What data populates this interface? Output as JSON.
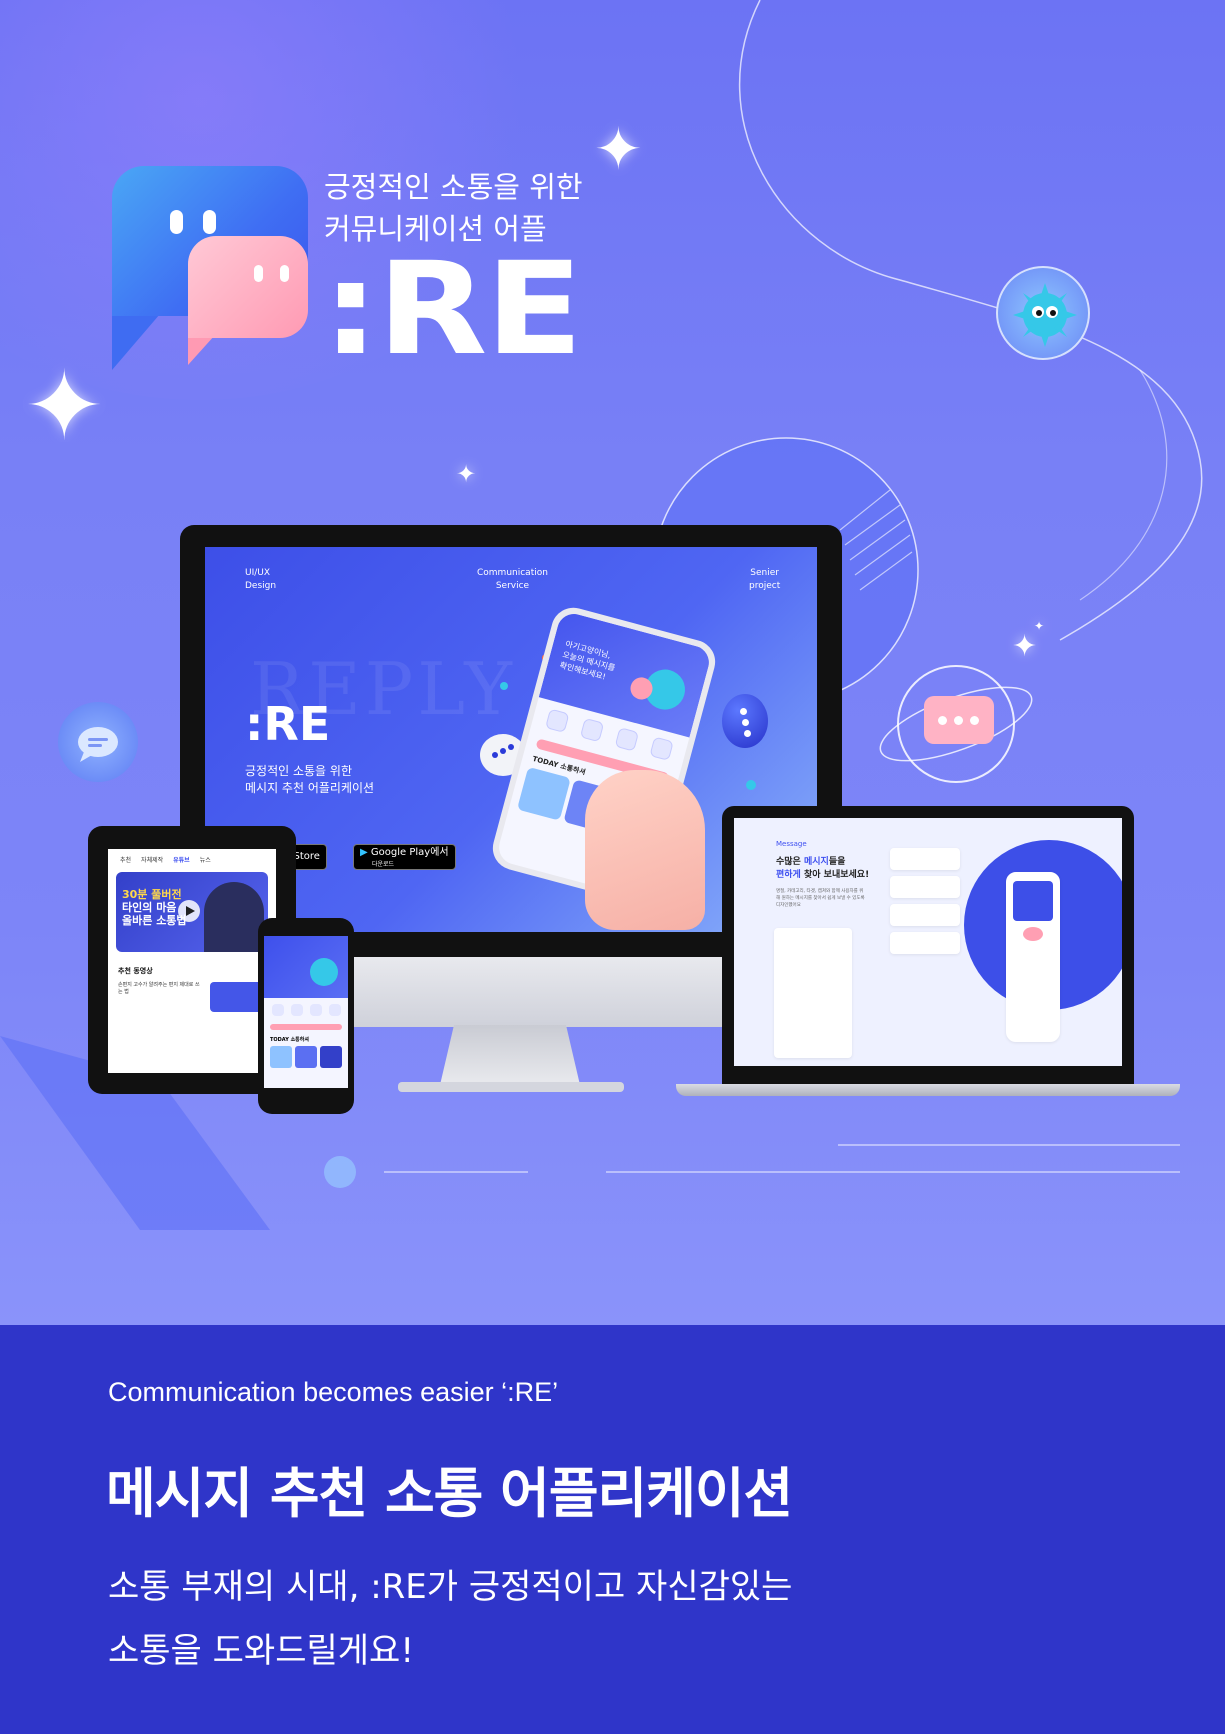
{
  "hero": {
    "tagline_line1": "긍정적인 소통을 위한",
    "tagline_line2": "커뮤니케이션 어플",
    "logo_text": ":RE",
    "colors": {
      "background": "#7880f6",
      "accent_blue": "#3d4ff0",
      "accent_pink": "#ff9ab3"
    }
  },
  "monitor": {
    "label_left": [
      "UI/UX",
      "Design"
    ],
    "label_center": [
      "Communication",
      "Service"
    ],
    "label_right": [
      "Senier",
      "project"
    ],
    "ghost_word": "REPLY",
    "logo_text": ":RE",
    "subtitle_line1": "긍정적인 소통을 위한",
    "subtitle_line2": "메시지 추천 어플리케이션",
    "app_store_label": "p Store",
    "google_play_small": "다운로드",
    "google_play_label": "Google Play에서",
    "phone_greeting": [
      "아기고양이님,",
      "오늘의 메시지를",
      "확인해보세요!"
    ],
    "phone_today": "TODAY 소통하셔"
  },
  "tablet": {
    "nav": [
      "추천",
      "자체제작",
      "유튜브",
      "뉴스"
    ],
    "video_title": [
      "30분 풀버전",
      "타인의 마음",
      "올바른 소통법"
    ],
    "section_title": "추천 동영상",
    "item_text": "손편지 고수가 알려주는 편지 제대로 쓰는 법"
  },
  "small_phone": {
    "today_label": "TODAY 소통하셔"
  },
  "laptop": {
    "message_label": "Message",
    "title_line1_prefix": "수많은 ",
    "title_line1_highlight": "메시지",
    "title_line1_suffix": "들을",
    "title_line2_highlight": "편하게",
    "title_line2_suffix": " 찾아 보내보세요!",
    "description": "명절, 카테고리, 타겟, 캡쳐와 함께 사용자를 위해 원하는 메시지를 찾아서 쉽게 보낼 수 있도록 디자인했어요"
  },
  "bottom": {
    "eyebrow": "Communication becomes easier ‘:RE’",
    "title": "메시지 추천 소통 어플리케이션",
    "desc_line1": "소통 부재의 시대, :RE가 긍정적이고 자신감있는",
    "desc_line2": "소통을 도와드릴게요!"
  }
}
